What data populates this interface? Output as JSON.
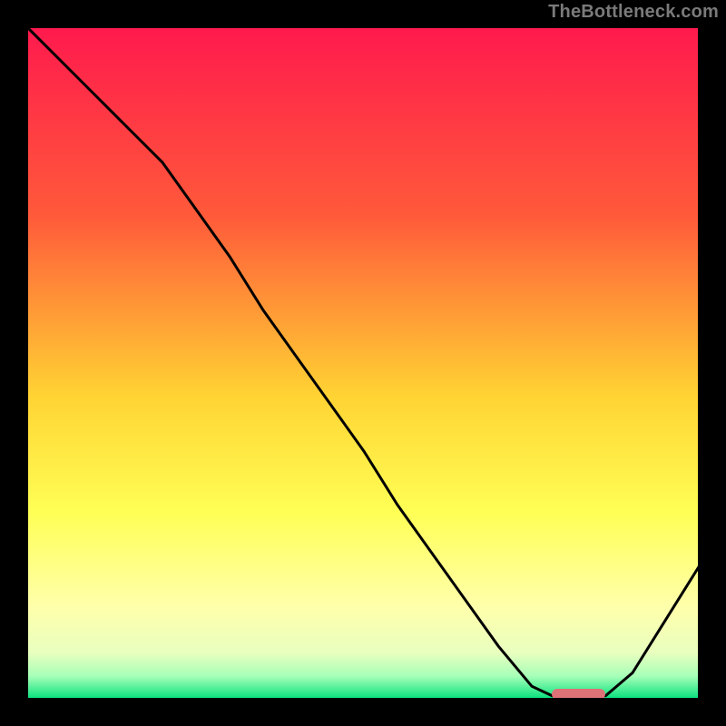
{
  "watermark": "TheBottleneck.com",
  "colors": {
    "top": "#ff1a4d",
    "mid1": "#ff7a33",
    "mid2": "#ffd433",
    "low1": "#ffff66",
    "low2": "#f7ffb3",
    "bottom": "#00e07a",
    "line": "#000000",
    "marker": "#de7277",
    "frame": "#000000"
  },
  "chart_data": {
    "type": "line",
    "title": "",
    "xlabel": "",
    "ylabel": "",
    "xlim": [
      0,
      100
    ],
    "ylim": [
      0,
      100
    ],
    "series": [
      {
        "name": "curve",
        "x": [
          0,
          5,
          10,
          15,
          20,
          25,
          30,
          35,
          40,
          45,
          50,
          55,
          60,
          65,
          70,
          75,
          78,
          82,
          86,
          90,
          95,
          100
        ],
        "y": [
          100,
          95,
          90,
          85,
          80,
          73,
          66,
          58,
          51,
          44,
          37,
          29,
          22,
          15,
          8,
          2,
          0.6,
          0.6,
          0.6,
          4,
          12,
          20
        ]
      }
    ],
    "marker": {
      "x_start": 78,
      "x_end": 86,
      "y": 0.8
    },
    "gradient_stops": [
      {
        "offset": 0.0,
        "color": "#ff1a4d"
      },
      {
        "offset": 0.28,
        "color": "#ff5a3a"
      },
      {
        "offset": 0.55,
        "color": "#ffd433"
      },
      {
        "offset": 0.72,
        "color": "#ffff55"
      },
      {
        "offset": 0.86,
        "color": "#ffffaa"
      },
      {
        "offset": 0.93,
        "color": "#e9ffbf"
      },
      {
        "offset": 0.965,
        "color": "#a6ffb8"
      },
      {
        "offset": 1.0,
        "color": "#00e07a"
      }
    ]
  }
}
